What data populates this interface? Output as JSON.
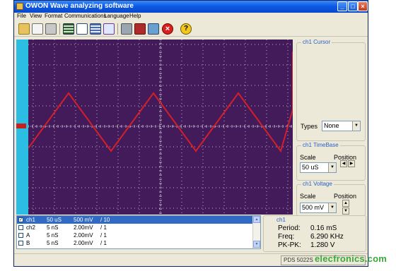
{
  "window": {
    "title": "OWON Wave analyzing software",
    "buttons": {
      "minimize": "_",
      "maximize": "□",
      "close": "×"
    }
  },
  "menu": [
    "File",
    "View",
    "Format",
    "Communications",
    "Language",
    "Help"
  ],
  "toolbar": {
    "tools": [
      "open-folder-icon",
      "print-preview-icon",
      "print-icon",
      "table-icon",
      "export-icon",
      "list-view-icon",
      "chart-view-icon",
      "tools-icon",
      "device-connect-icon",
      "network-icon",
      "stop-icon",
      "help-icon"
    ]
  },
  "colors": {
    "screen_bg": "#431a5a",
    "grid": "#b9b2c2",
    "trace": "#d0202a",
    "channel_strip": "#2bbde2",
    "selection": "#316ac5"
  },
  "cursor_panel": {
    "legend": "ch1 Cursor",
    "types_label": "Types",
    "types_value": "None"
  },
  "timebase_panel": {
    "legend": "ch1 TimeBase",
    "scale_label": "Scale",
    "position_label": "Position",
    "scale_value": "50 uS"
  },
  "voltage_panel": {
    "legend": "ch1 Voltage",
    "scale_label": "Scale",
    "position_label": "Position",
    "scale_value": "500 mV"
  },
  "channel_list": [
    {
      "checked": true,
      "name": "ch1",
      "time": "50 uS",
      "volt": "500 mV",
      "probe": "/ 10",
      "selected": true
    },
    {
      "checked": false,
      "name": "ch2",
      "time": "5 nS",
      "volt": "2.00mV",
      "probe": "/ 1",
      "selected": false
    },
    {
      "checked": false,
      "name": "A",
      "time": "5 nS",
      "volt": "2.00mV",
      "probe": "/ 1",
      "selected": false
    },
    {
      "checked": false,
      "name": "B",
      "time": "5 nS",
      "volt": "2.00mV",
      "probe": "/ 1",
      "selected": false
    }
  ],
  "measurements": {
    "channel": "ch1",
    "period_label": "Period:",
    "period_value": "0.16 mS",
    "freq_label": "Freq:",
    "freq_value": "6.290 KHz",
    "pkpk_label": "PK-PK:",
    "pkpk_value": "1.280 V"
  },
  "status": {
    "device": "PDS 5022S"
  },
  "watermark": "elecfronics.com"
}
